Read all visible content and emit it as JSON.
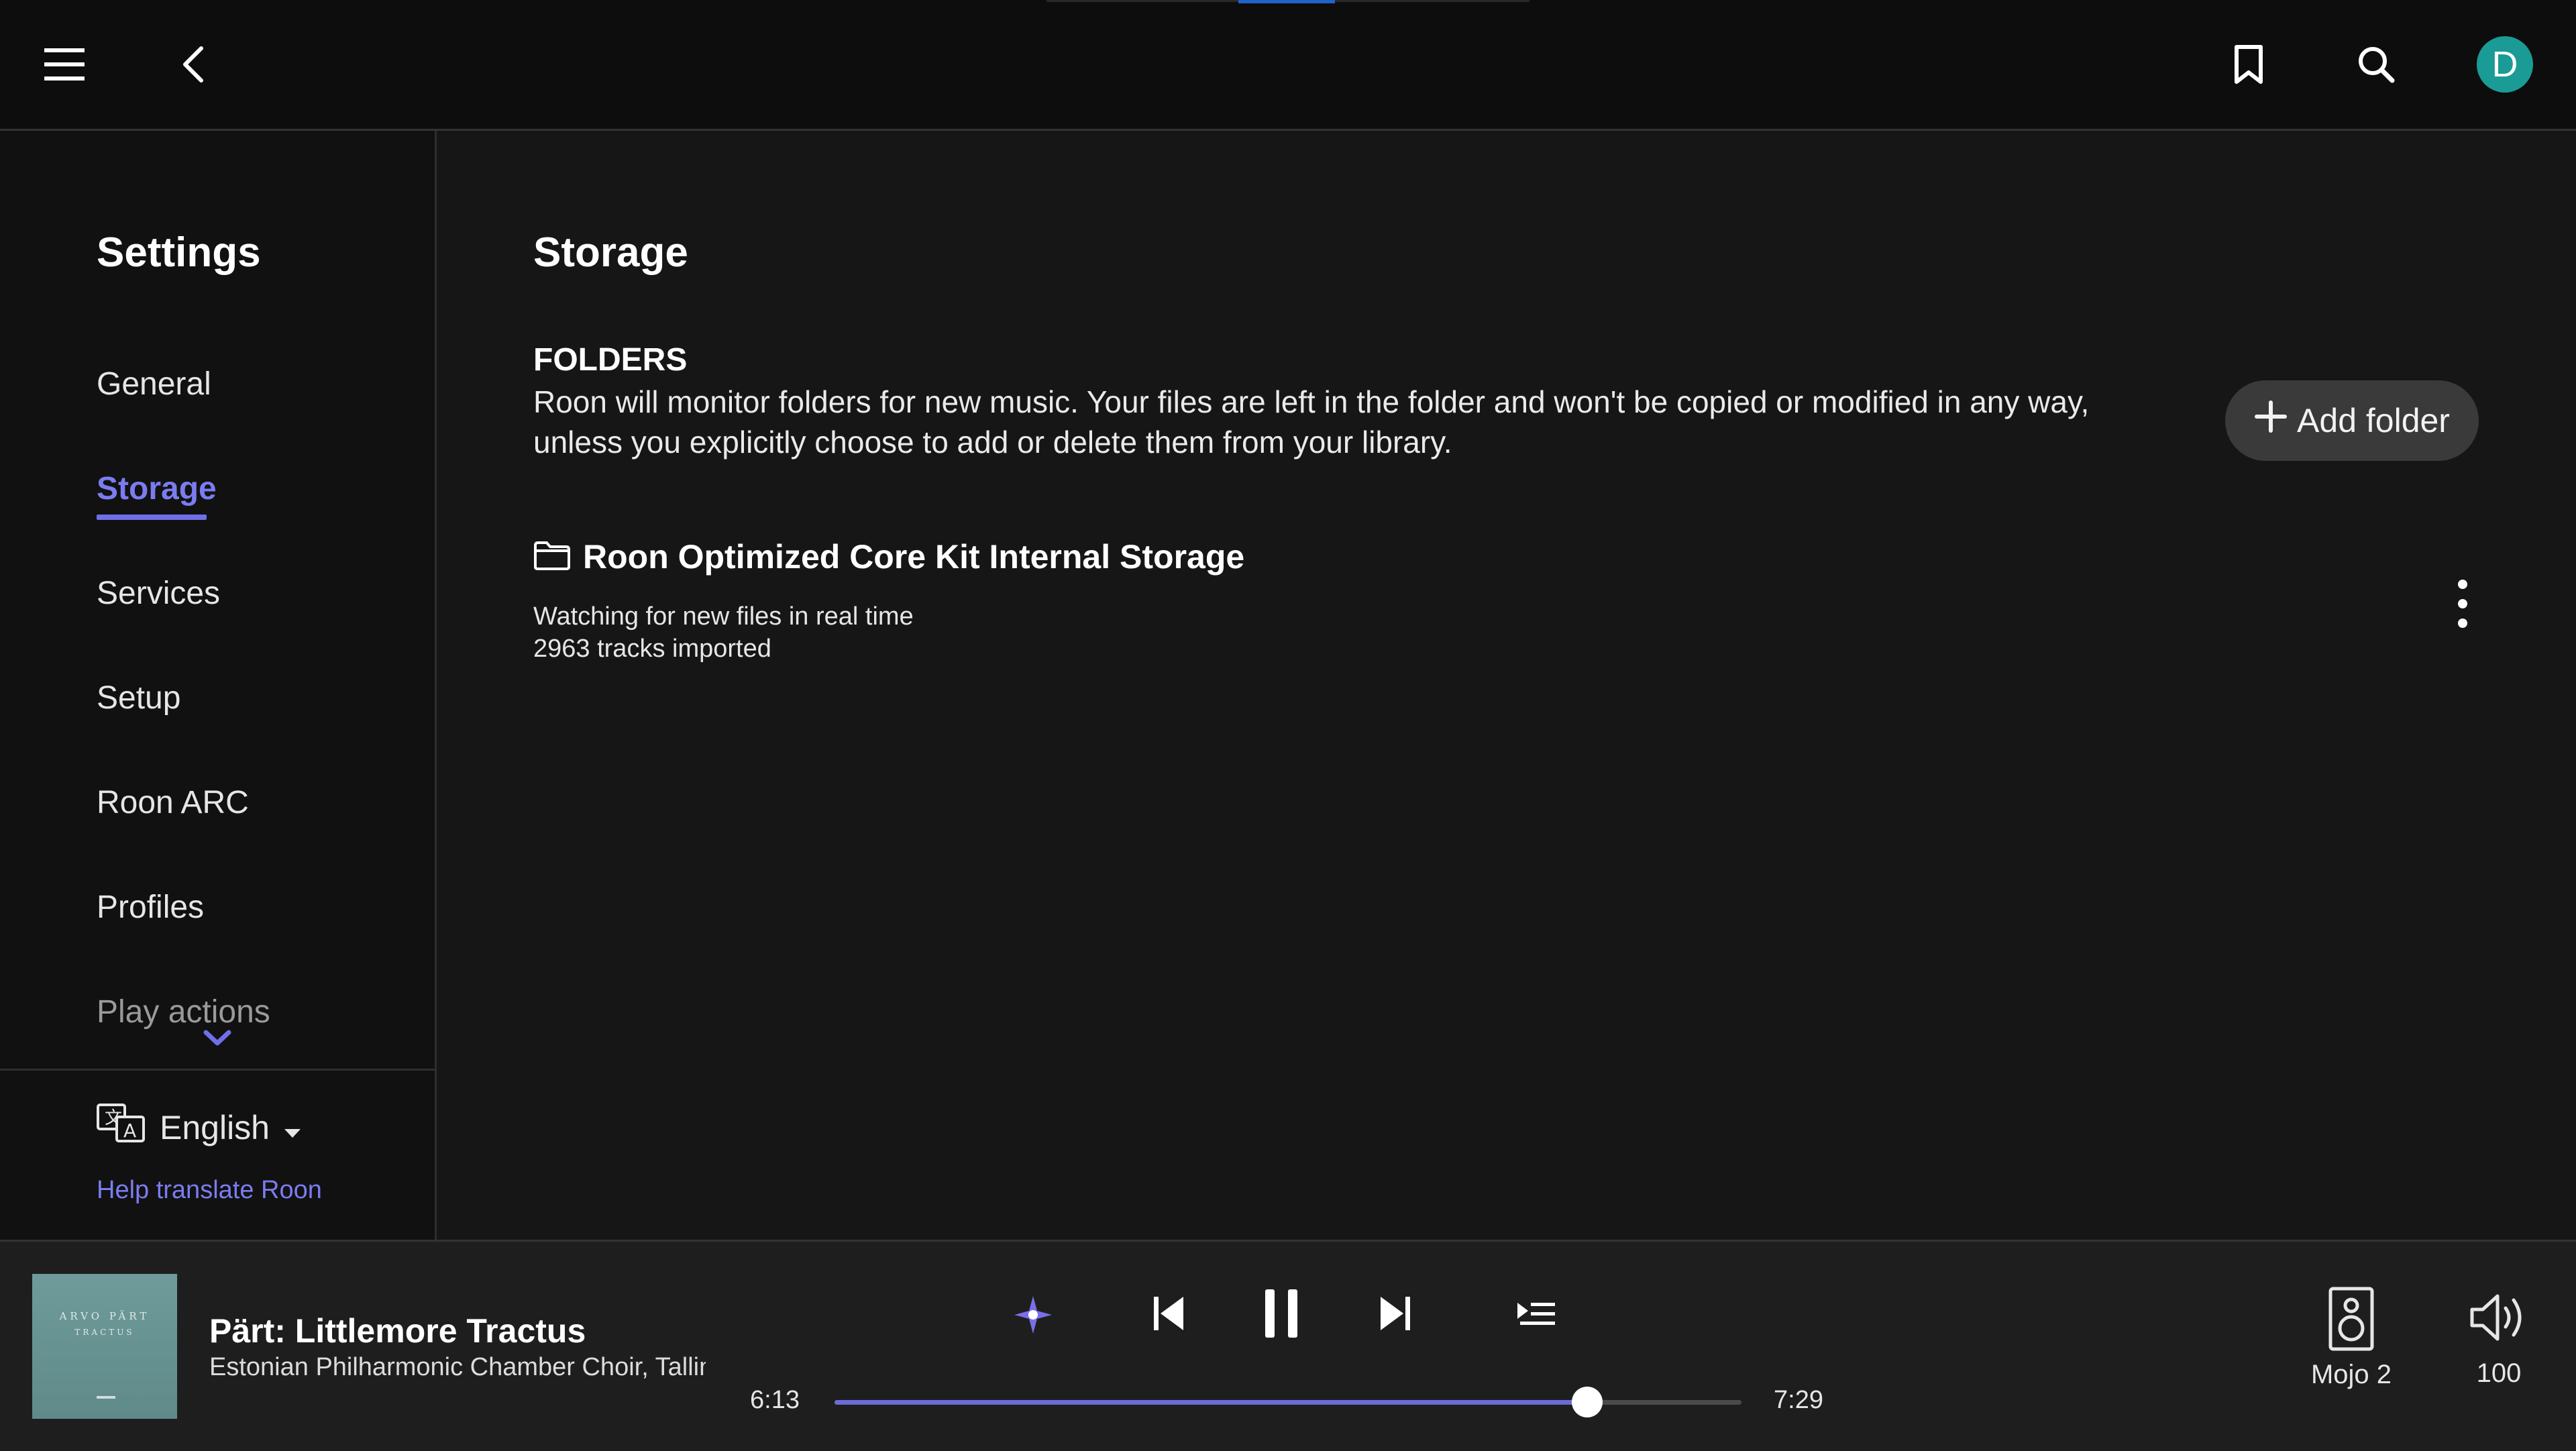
{
  "header": {
    "menu_icon": "hamburger-menu-icon",
    "back_icon": "chevron-left-icon",
    "bookmark_icon": "bookmark-icon",
    "search_icon": "search-icon",
    "avatar_initial": "D",
    "avatar_color": "#1a9b95"
  },
  "sidebar": {
    "title": "Settings",
    "items": [
      {
        "label": "General"
      },
      {
        "label": "Storage",
        "active": true
      },
      {
        "label": "Services"
      },
      {
        "label": "Setup"
      },
      {
        "label": "Roon ARC"
      },
      {
        "label": "Profiles"
      },
      {
        "label": "Play actions"
      }
    ],
    "language": "English",
    "help_link": "Help translate Roon"
  },
  "main": {
    "title": "Storage",
    "folders": {
      "heading": "FOLDERS",
      "description": "Roon will monitor folders for new music. Your files are left in the folder and won't be copied or modified in any way, unless you explicitly choose to add or delete them from your library.",
      "add_button": "Add folder",
      "items": [
        {
          "name": "Roon Optimized Core Kit Internal Storage",
          "status": "Watching for new files in real time",
          "count": "2963 tracks imported"
        }
      ]
    }
  },
  "player": {
    "album_art": {
      "line1": "ARVO PÄRT",
      "line2": "TRACTUS"
    },
    "track_title": "Pärt: Littlemore Tractus",
    "track_artist": "Estonian Philharmonic Chamber Choir, Tallinn Chamber Orchestra, Tõnu Kaljuste",
    "elapsed": "6:13",
    "duration": "7:29",
    "progress": 0.83,
    "zone": "Mojo 2",
    "volume": "100",
    "accent_color": "#6b6bd9"
  }
}
